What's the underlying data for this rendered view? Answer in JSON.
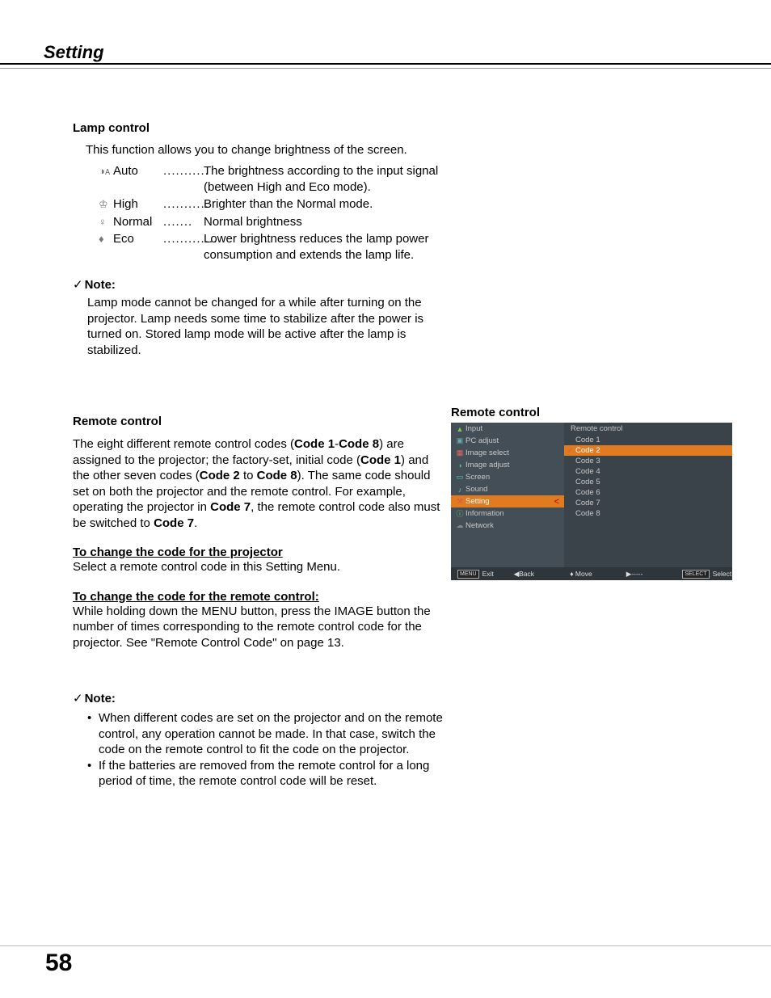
{
  "page": {
    "title": "Setting",
    "number": "58"
  },
  "lamp": {
    "heading": "Lamp control",
    "intro": "This function allows you to change brightness of the screen.",
    "items": [
      {
        "icon": "◑ᴀ",
        "label": "Auto",
        "dots": "...........",
        "desc": "The brightness according to the input signal (between High and Eco mode)."
      },
      {
        "icon": "♔",
        "label": "High",
        "dots": "...........",
        "desc": "Brighter than the Normal mode."
      },
      {
        "icon": "♀",
        "label": "Normal",
        "dots": ".......",
        "desc": "Normal brightness"
      },
      {
        "icon": "♦",
        "label": "Eco",
        "dots": ".............",
        "desc": "Lower brightness reduces the lamp power consumption and extends the lamp life."
      }
    ],
    "note_head": "Note:",
    "note_body": "Lamp mode cannot be changed for a while after turning on the projector. Lamp needs some time to stabilize after the power is turned on. Stored lamp mode will be active after the lamp is stabilized."
  },
  "remote": {
    "heading": "Remote control",
    "para_parts": {
      "p1": "The eight different remote control codes (",
      "b1": "Code 1",
      "dash": "-",
      "b2": "Code 8",
      "p2": ") are assigned to the projector; the factory-set, initial code (",
      "b3": "Code 1",
      "p3": ") and the other seven codes (",
      "b4": "Code 2",
      "p4": " to ",
      "b5": "Code 8",
      "p5": "). The same code should set on both the projector and the remote control. For example, operating the projector in ",
      "b6": "Code 7",
      "p6": ", the remote control code also must be switched to ",
      "b7": "Code 7",
      "p7": "."
    },
    "sub1_title": "To change the code for the projector",
    "sub1_body": "Select a remote control code in this Setting Menu.",
    "sub2_title": "To change the code for the remote control:",
    "sub2_body": "While holding down the MENU button, press the IMAGE button the number of times corresponding to the remote control code for the projector. See \"Remote Control Code\" on page 13.",
    "note_head": "Note:",
    "bullets": [
      "When different codes are set on the projector and on the remote control, any operation cannot be made. In that case, switch the code on the remote control to fit the code on the projector.",
      "If the batteries are removed from the remote control for a long period of time, the remote control code will be reset."
    ]
  },
  "osd": {
    "title": "Remote control",
    "menu": [
      {
        "label": "Input",
        "cls": "green",
        "glyph": "▲"
      },
      {
        "label": "PC adjust",
        "cls": "blue",
        "glyph": "▣"
      },
      {
        "label": "Image select",
        "cls": "red",
        "glyph": "▦"
      },
      {
        "label": "Image adjust",
        "cls": "gb",
        "glyph": "◑"
      },
      {
        "label": "Screen",
        "cls": "cyan",
        "glyph": "▭"
      },
      {
        "label": "Sound",
        "cls": "cyan",
        "glyph": "♪"
      },
      {
        "label": "Setting",
        "cls": "redtool",
        "glyph": "⚒",
        "selected": true
      },
      {
        "label": "Information",
        "cls": "info",
        "glyph": "ⓘ"
      },
      {
        "label": "Network",
        "cls": "net",
        "glyph": "☁"
      }
    ],
    "panel_head": "Remote control",
    "codes": [
      {
        "label": "Code 1",
        "tick": false,
        "sel": false
      },
      {
        "label": "Code 2",
        "tick": true,
        "sel": true
      },
      {
        "label": "Code 3",
        "tick": false,
        "sel": false
      },
      {
        "label": "Code 4",
        "tick": false,
        "sel": false
      },
      {
        "label": "Code 5",
        "tick": false,
        "sel": false
      },
      {
        "label": "Code 6",
        "tick": false,
        "sel": false
      },
      {
        "label": "Code 7",
        "tick": false,
        "sel": false
      },
      {
        "label": "Code 8",
        "tick": false,
        "sel": false
      }
    ],
    "footer": {
      "exit_box": "MENU",
      "exit": "Exit",
      "back": "◀Back",
      "move": "♦ Move",
      "dash": "▶-----",
      "select_box": "SELECT",
      "select": "Select"
    }
  }
}
